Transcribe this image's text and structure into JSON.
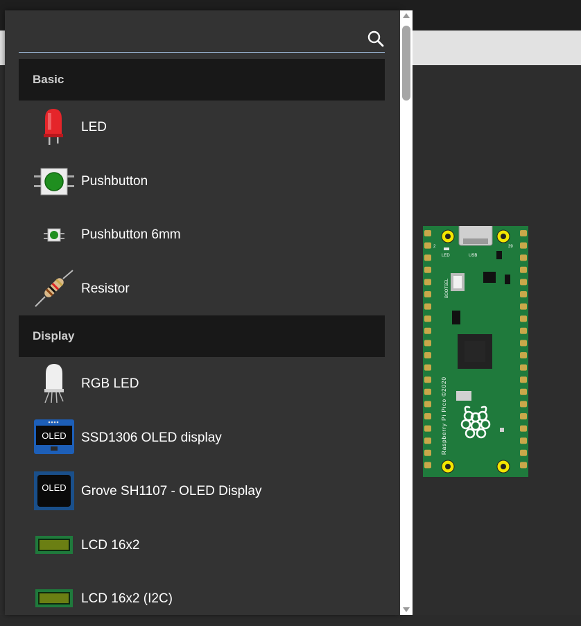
{
  "search": {
    "value": "",
    "placeholder": "",
    "icon": "search-icon"
  },
  "categories": [
    {
      "name": "Basic",
      "items": [
        {
          "label": "LED",
          "icon": "led-icon"
        },
        {
          "label": "Pushbutton",
          "icon": "pushbutton-icon"
        },
        {
          "label": "Pushbutton 6mm",
          "icon": "pushbutton-6mm-icon"
        },
        {
          "label": "Resistor",
          "icon": "resistor-icon"
        }
      ]
    },
    {
      "name": "Display",
      "items": [
        {
          "label": "RGB LED",
          "icon": "rgb-led-icon"
        },
        {
          "label": "SSD1306 OLED display",
          "icon": "oled-display-icon",
          "icon_text": "OLED"
        },
        {
          "label": "Grove SH1107 - OLED Display",
          "icon": "grove-oled-icon",
          "icon_text": "OLED"
        },
        {
          "label": "LCD 16x2",
          "icon": "lcd-icon"
        },
        {
          "label": "LCD 16x2 (I2C)",
          "icon": "lcd-i2c-icon"
        }
      ]
    }
  ],
  "board": {
    "name": "Raspberry Pi Pico",
    "silkscreen": "Raspberry Pi Pico ©2020",
    "labels": {
      "led": "LED",
      "usb": "USB",
      "bootsel": "BOOTSEL",
      "pin_left": "2",
      "pin_right": "39"
    }
  },
  "colors": {
    "popup_bg": "#333333",
    "category_bg": "#181818",
    "board_green": "#1f7a3c",
    "search_underline": "#9bb6d4"
  }
}
